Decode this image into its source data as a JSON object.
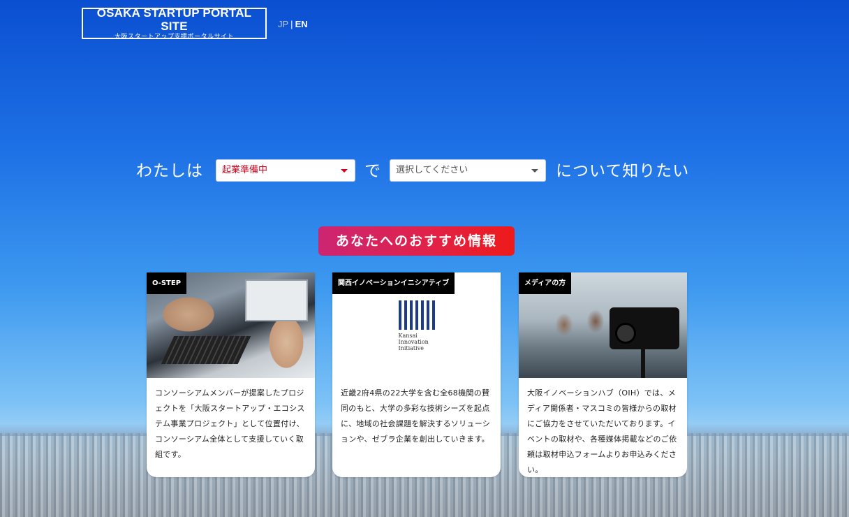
{
  "header": {
    "logo_main": "OSAKA STARTUP PORTAL SITE",
    "logo_sub": "大阪スタートアップ支援ポータルサイト",
    "lang_jp": "JP",
    "lang_sep": "|",
    "lang_en": "EN"
  },
  "sentence": {
    "prefix": "わたしは",
    "middle": "で",
    "suffix": "について知りたい",
    "select_status": "起業準備中",
    "select_topic_placeholder": "選択してください"
  },
  "recommend": {
    "title": "あなたへのおすすめ情報"
  },
  "cards": [
    {
      "tag": "O-STEP",
      "text": "コンソーシアムメンバーが提案したプロジェクトを「大阪スタートアップ・エコシステム事業プロジェクト」として位置付け、コンソーシアム全体として支援していく取組です。"
    },
    {
      "tag": "関西イノベーションイニシアティブ",
      "logo_mark": "KSII",
      "logo_line1": "Kansai",
      "logo_line2": "Innovation",
      "logo_line3": "Initiative",
      "text": "近畿2府4県の22大学を含む全68機関の賛同のもと、大学の多彩な技術シーズを起点に、地域の社会課題を解決するソリューションや、ゼブラ企業を創出していきます。"
    },
    {
      "tag": "メディアの方",
      "text": "大阪イノベーションハブ（OIH）では、メディア関係者・マスコミの皆様からの取材にご協力をさせていただいております。イベントの取材や、各種媒体掲載などのご依頼は取材申込フォームよりお申込みください。"
    }
  ],
  "colors": {
    "sky_top": "#0a4fd1",
    "badge_start": "#cc2572",
    "badge_end": "#ee1a1a",
    "status_red": "#d0021b",
    "ksii_blue": "#1b3c8d"
  }
}
